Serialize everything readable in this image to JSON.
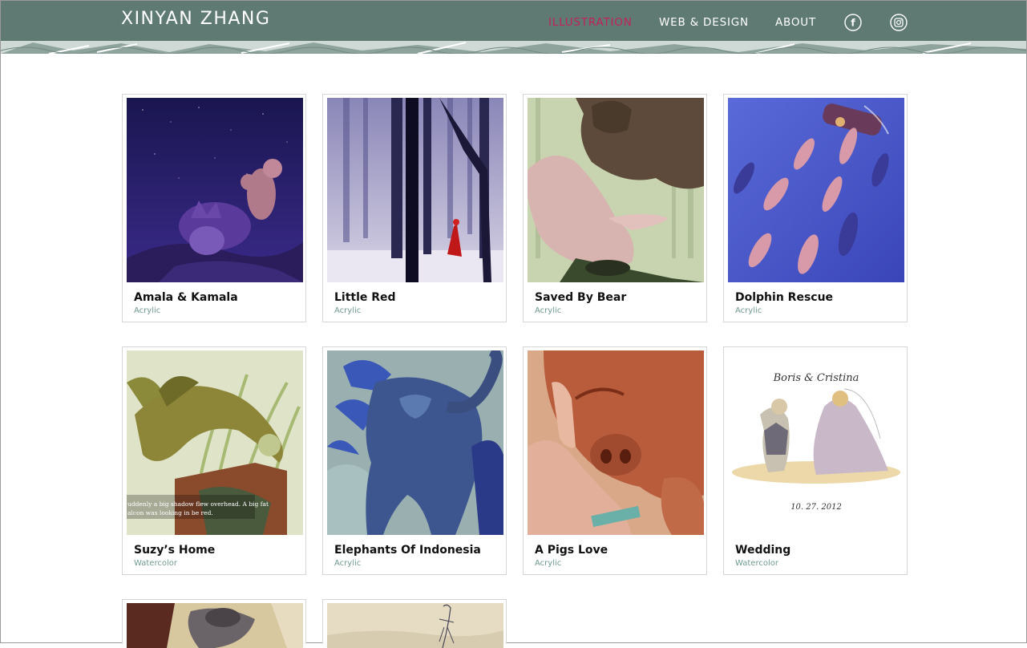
{
  "header": {
    "logo": "XINYAN ZHANG",
    "nav": [
      {
        "label": "ILLUSTRATION",
        "active": true
      },
      {
        "label": "WEB & DESIGN",
        "active": false
      },
      {
        "label": "ABOUT",
        "active": false
      }
    ],
    "social": [
      {
        "icon": "facebook-icon",
        "glyph": "f"
      },
      {
        "icon": "instagram-icon"
      }
    ],
    "colors": {
      "bar": "#5f7a72",
      "active": "#c1225b",
      "text": "#ffffff"
    }
  },
  "gallery": {
    "items": [
      {
        "title": "Amala & Kamala",
        "medium": "Acrylic"
      },
      {
        "title": "Little Red",
        "medium": "Acrylic"
      },
      {
        "title": "Saved By Bear",
        "medium": "Acrylic"
      },
      {
        "title": "Dolphin Rescue",
        "medium": "Acrylic"
      },
      {
        "title": "Suzy’s Home",
        "medium": "Watercolor",
        "caption_lines": [
          "uddenly a big shadow flew overhead. A big fat",
          "alcon was looking in be red."
        ]
      },
      {
        "title": "Elephants Of Indonesia",
        "medium": "Acrylic"
      },
      {
        "title": "A Pigs Love",
        "medium": "Acrylic"
      },
      {
        "title": "Wedding",
        "medium": "Watercolor",
        "art_text": {
          "names": "Boris & Cristina",
          "date": "10. 27. 2012"
        }
      }
    ],
    "medium_color": "#6f9a8f"
  }
}
